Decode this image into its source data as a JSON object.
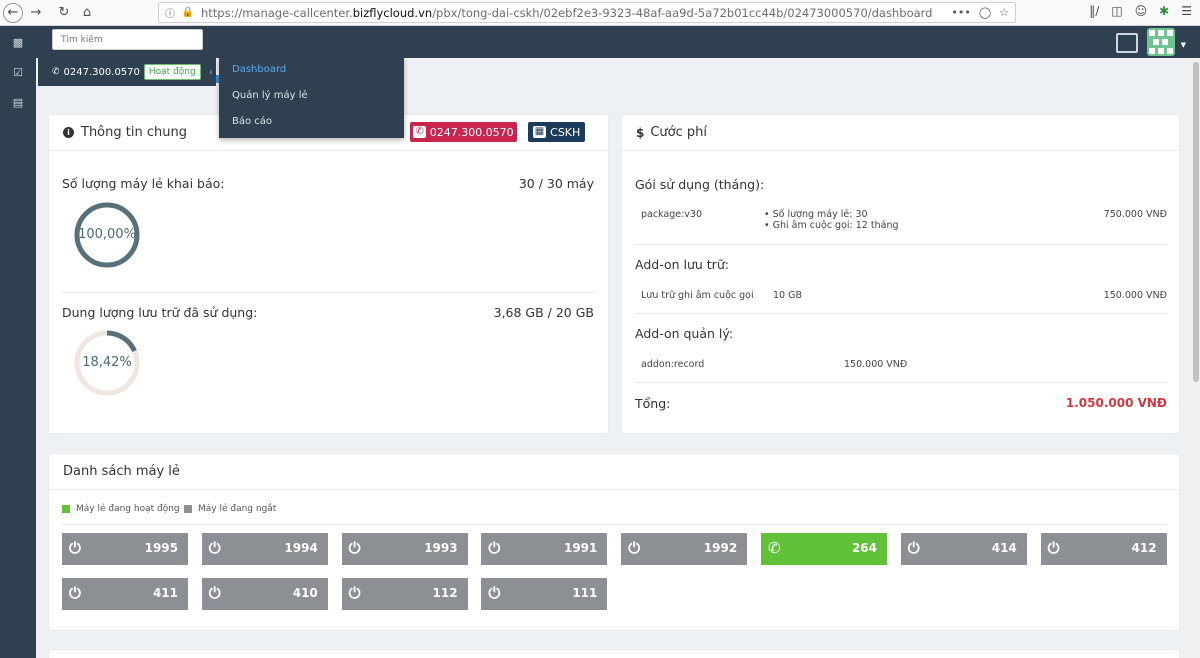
{
  "browser": {
    "url_prefix": "https://manage-callcenter.",
    "url_domain": "bizflycloud.vn",
    "url_path": "/pbx/tong-dai-cskh/02ebf2e3-9323-48af-aa9d-5a72b01cc44b/02473000570/dashboard",
    "url_more": "•••"
  },
  "header": {
    "search_placeholder": "Tìm kiếm"
  },
  "line_panel": {
    "number": "0247.300.0570",
    "status": "Hoạt động"
  },
  "menu": {
    "items": [
      {
        "label": "Dashboard"
      },
      {
        "label": "Quản lý máy lẻ"
      },
      {
        "label": "Báo cáo"
      }
    ]
  },
  "info_card": {
    "title": "Thông tin chung",
    "phone_pill": "0247.300.0570",
    "group_pill": "CSKH",
    "ext_label": "Số lượng máy lẻ khai báo:",
    "ext_value": "30 / 30 máy",
    "ext_percent_text": "100,00%",
    "ext_percent": 100,
    "storage_label": "Dung lượng lưu trữ đã sử dụng:",
    "storage_value": "3,68 GB / 20 GB",
    "storage_percent_text": "18,42%",
    "storage_percent": 18.42
  },
  "fee_card": {
    "title": "Cước phí",
    "plan_heading": "Gói sử dụng (tháng):",
    "plan_name": "package:v30",
    "plan_feature_1": "• Số lượng máy lẻ: 30",
    "plan_feature_2": "• Ghi âm cuộc gọi: 12 tháng",
    "plan_price": "750.000 VNĐ",
    "storage_heading": "Add-on lưu trữ:",
    "storage_name": "Lưu trữ ghi âm cuộc gọi",
    "storage_size": "10 GB",
    "storage_price": "150.000 VNĐ",
    "manage_heading": "Add-on quản lý:",
    "manage_name": "addon:record",
    "manage_price": "150.000 VNĐ",
    "total_label": "Tổng:",
    "total_value": "1.050.000 VNĐ"
  },
  "ext_list": {
    "title": "Danh sách máy lẻ",
    "legend_active": "Máy lẻ đang hoạt động",
    "legend_off": "Máy lẻ đang ngắt",
    "color_active": "#62c13a",
    "color_off": "#8c8f94",
    "items": [
      {
        "number": "1995",
        "status": "off"
      },
      {
        "number": "1994",
        "status": "off"
      },
      {
        "number": "1993",
        "status": "off"
      },
      {
        "number": "1991",
        "status": "off"
      },
      {
        "number": "1992",
        "status": "off"
      },
      {
        "number": "264",
        "status": "active"
      },
      {
        "number": "414",
        "status": "off"
      },
      {
        "number": "412",
        "status": "off"
      },
      {
        "number": "411",
        "status": "off"
      },
      {
        "number": "410",
        "status": "off"
      },
      {
        "number": "112",
        "status": "off"
      },
      {
        "number": "111",
        "status": "off"
      }
    ]
  }
}
